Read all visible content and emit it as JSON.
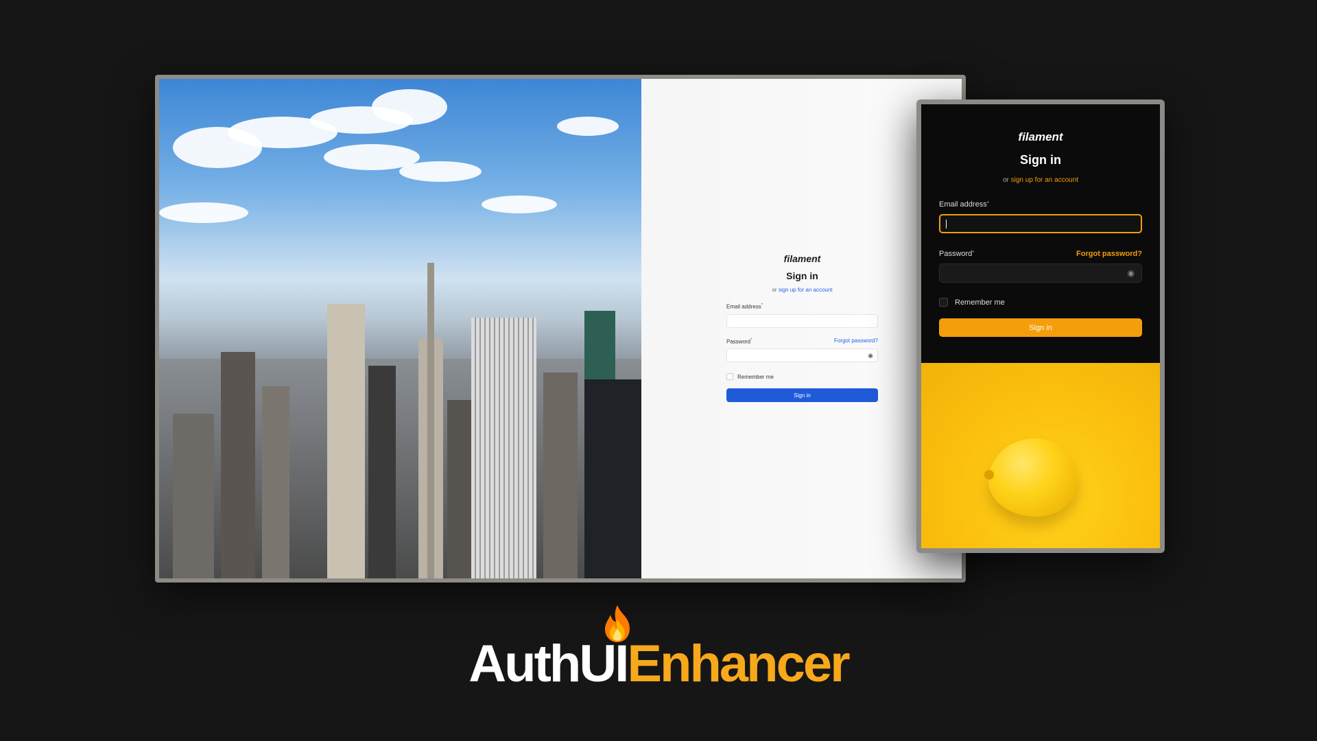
{
  "desktop_form": {
    "brand": "filament",
    "title": "Sign in",
    "subtitle_prefix": "or",
    "subtitle_link": "sign up for an account",
    "email_label": "Email address",
    "password_label": "Password",
    "required_mark": "*",
    "forgot_password": "Forgot password?",
    "remember_me": "Remember me",
    "submit": "Sign in",
    "accent_color": "#1f5bd9",
    "background_image": "city-skyline"
  },
  "mobile_form": {
    "brand": "filament",
    "title": "Sign in",
    "subtitle_prefix": "or",
    "subtitle_link": "sign up for an account",
    "email_label": "Email address",
    "password_label": "Password",
    "required_mark": "*",
    "forgot_password": "Forgot password?",
    "remember_me": "Remember me",
    "submit": "Sign in",
    "accent_color": "#f59e0b",
    "background_image": "lemon-on-yellow"
  },
  "branding": {
    "part_white": "AuthUI",
    "part_orange": "Enhancer",
    "icon": "flame-icon",
    "orange_color": "#f7a81b"
  }
}
